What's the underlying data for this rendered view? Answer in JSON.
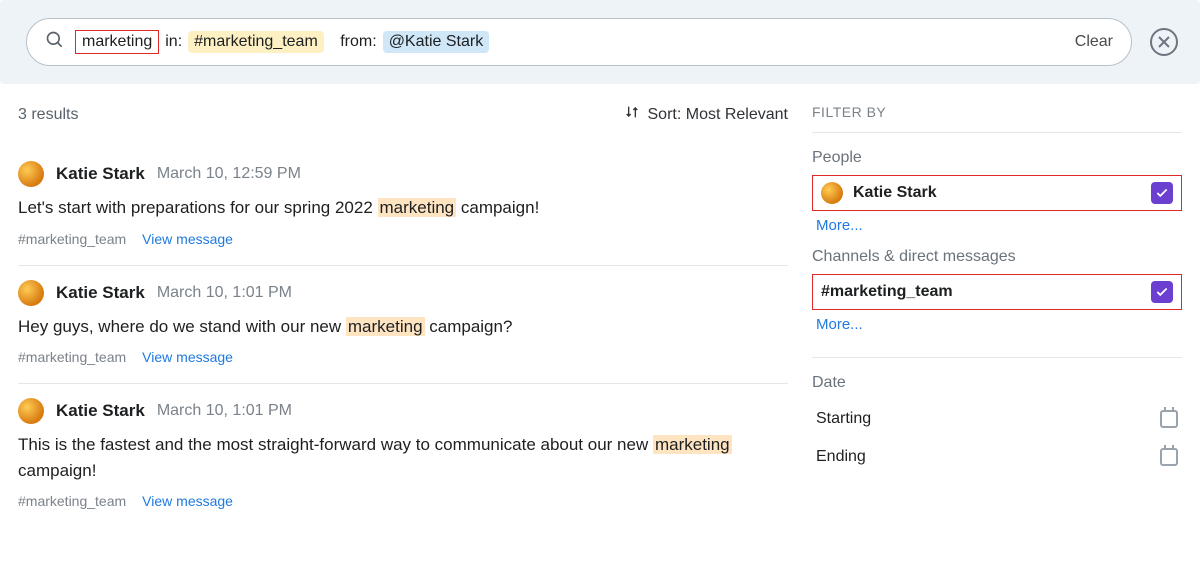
{
  "search": {
    "term": "marketing",
    "in_label": "in:",
    "channel_chip": "#marketing_team",
    "from_label": "from:",
    "user_chip": "@Katie Stark",
    "clear": "Clear"
  },
  "results": {
    "count_label": "3 results",
    "sort_label": "Sort: Most Relevant",
    "items": [
      {
        "author": "Katie Stark",
        "when": "March 10, 12:59 PM",
        "pre": "Let's start with preparations for our spring 2022 ",
        "hit": "marketing",
        "post": " campaign!",
        "channel": "#marketing_team",
        "view": "View message"
      },
      {
        "author": "Katie Stark",
        "when": "March 10, 1:01 PM",
        "pre": "Hey guys, where do we stand with our new ",
        "hit": "marketing",
        "post": " campaign?",
        "channel": "#marketing_team",
        "view": "View message"
      },
      {
        "author": "Katie Stark",
        "when": "March 10, 1:01 PM",
        "pre": "This is the fastest and the most straight-forward way to communicate about our new ",
        "hit": "marketing",
        "post": " campaign!",
        "channel": "#marketing_team",
        "view": "View message"
      }
    ]
  },
  "sidebar": {
    "title": "FILTER BY",
    "people_label": "People",
    "people_item": "Katie Stark",
    "channels_label": "Channels & direct messages",
    "channels_item": "#marketing_team",
    "more": "More...",
    "date_label": "Date",
    "date_start": "Starting",
    "date_end": "Ending"
  }
}
